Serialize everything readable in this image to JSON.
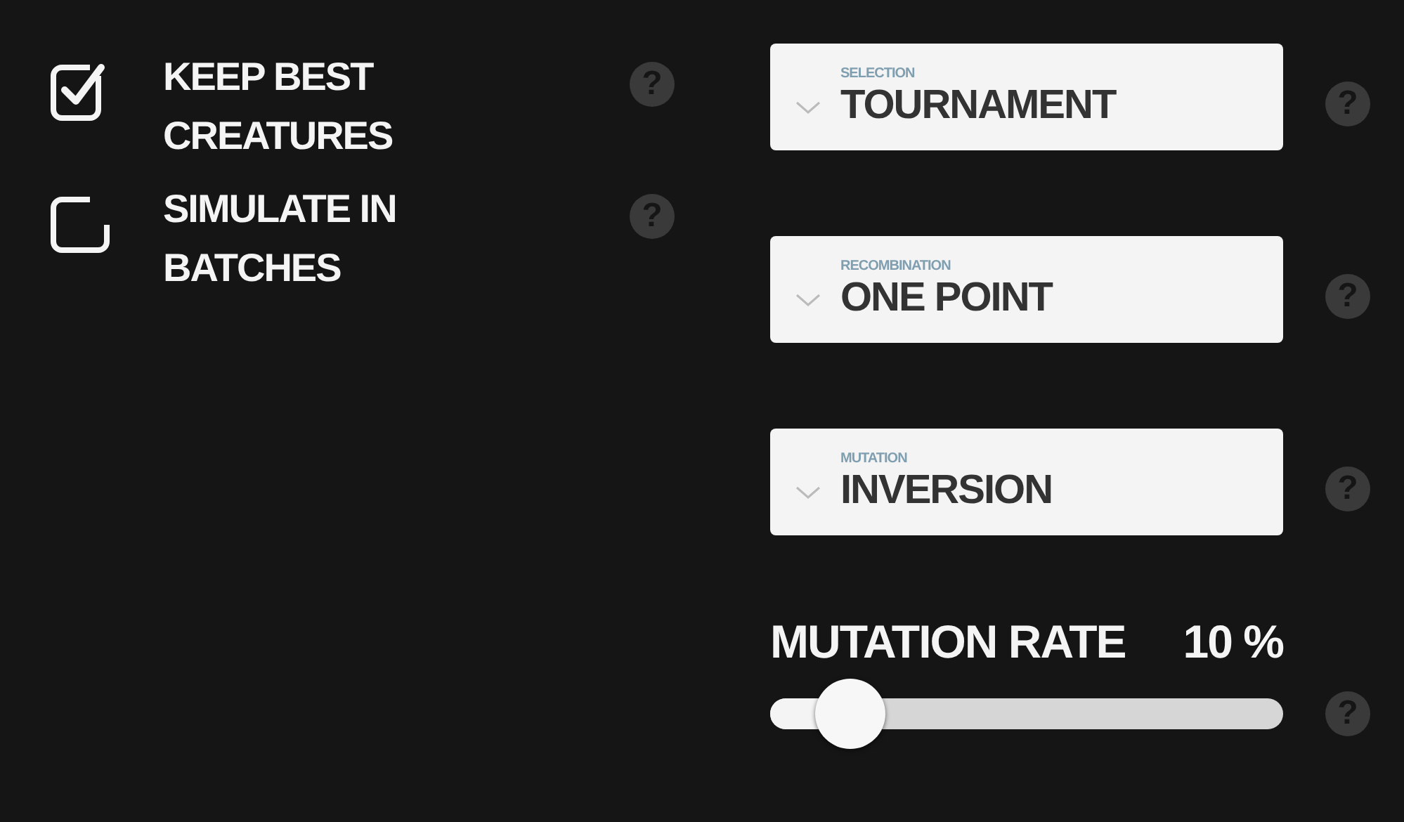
{
  "options": [
    {
      "label": "KEEP BEST CREATURES",
      "checked": true,
      "help": "?"
    },
    {
      "label": "SIMULATE IN BATCHES",
      "checked": false,
      "help": "?"
    }
  ],
  "dropdowns": [
    {
      "caption": "SELECTION",
      "value": "TOURNAMENT",
      "help": "?"
    },
    {
      "caption": "RECOMBINATION",
      "value": "ONE POINT",
      "help": "?"
    },
    {
      "caption": "MUTATION",
      "value": "INVERSION",
      "help": "?"
    }
  ],
  "mutation_rate": {
    "label": "MUTATION RATE",
    "reading": "10 %",
    "level": 0.1,
    "help": "?"
  }
}
